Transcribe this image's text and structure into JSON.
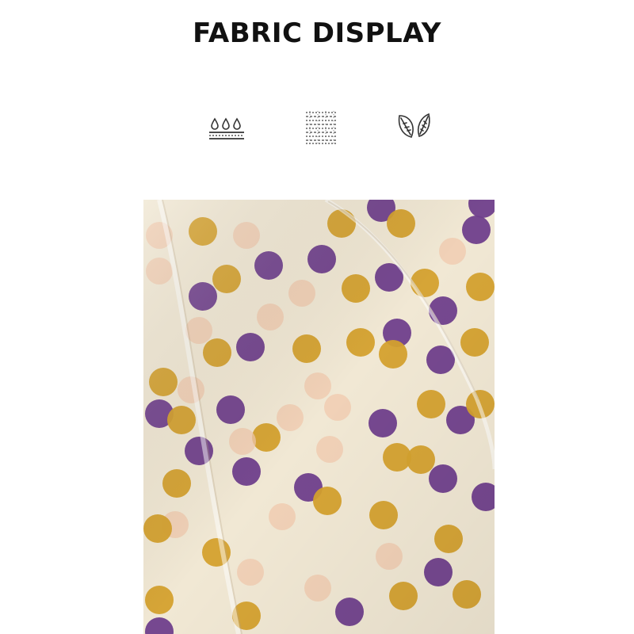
{
  "title": "FABRIC DISPLAY",
  "features": [
    {
      "icon": "water-drops-icon"
    },
    {
      "icon": "fabric-weave-icon"
    },
    {
      "icon": "leaf-icon"
    }
  ],
  "fabric": {
    "description_icon": "polka-dot-fabric-photo",
    "colors": {
      "background": "#f1e8d4",
      "purple": "#6f3f8c",
      "mustard": "#d4a12e",
      "peach": "#f0c9ae",
      "white": "#faf6ee"
    }
  }
}
